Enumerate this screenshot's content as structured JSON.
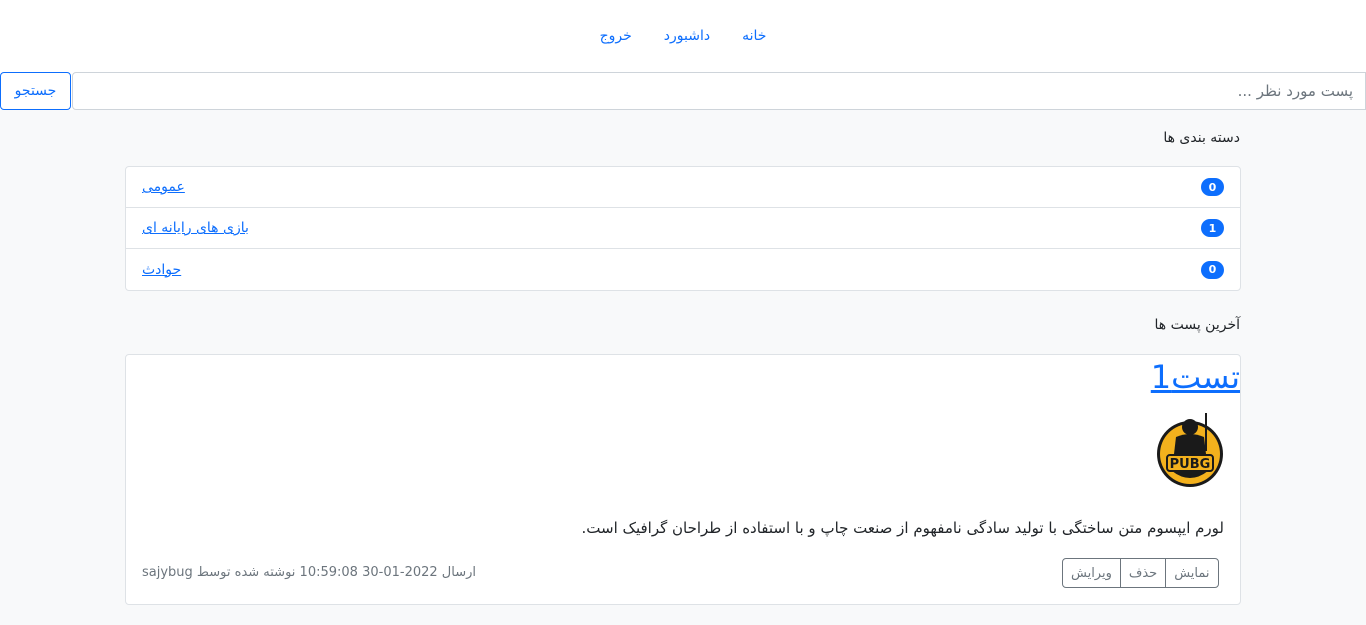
{
  "nav": {
    "items": [
      {
        "label": "خانه"
      },
      {
        "label": "داشبورد"
      },
      {
        "label": "خروج"
      }
    ]
  },
  "search": {
    "placeholder": "پست مورد نظر ...",
    "button_label": "جستجو"
  },
  "categories": {
    "title": "دسته بندی ها",
    "items": [
      {
        "label": "عمومی",
        "count": "0"
      },
      {
        "label": "بازی های رایانه ای",
        "count": "1"
      },
      {
        "label": "حوادث",
        "count": "0"
      }
    ]
  },
  "latest_posts": {
    "title": "آخرین پست ها",
    "posts": [
      {
        "title": "تست1",
        "image_icon": "pubg-logo",
        "body": "لورم ایپسوم متن ساختگی با تولید سادگی نامفهوم از صنعت چاپ و با استفاده از طراحان گرافیک است.",
        "meta": "ارسال 2022-01-30 10:59:08 نوشته شده توسط sajybug",
        "actions": {
          "view": "نمایش",
          "delete": "حذف",
          "edit": "ویرایش"
        }
      }
    ]
  },
  "colors": {
    "primary": "#0d6efd",
    "background": "#f8f9fa",
    "secondary": "#6c757d"
  }
}
